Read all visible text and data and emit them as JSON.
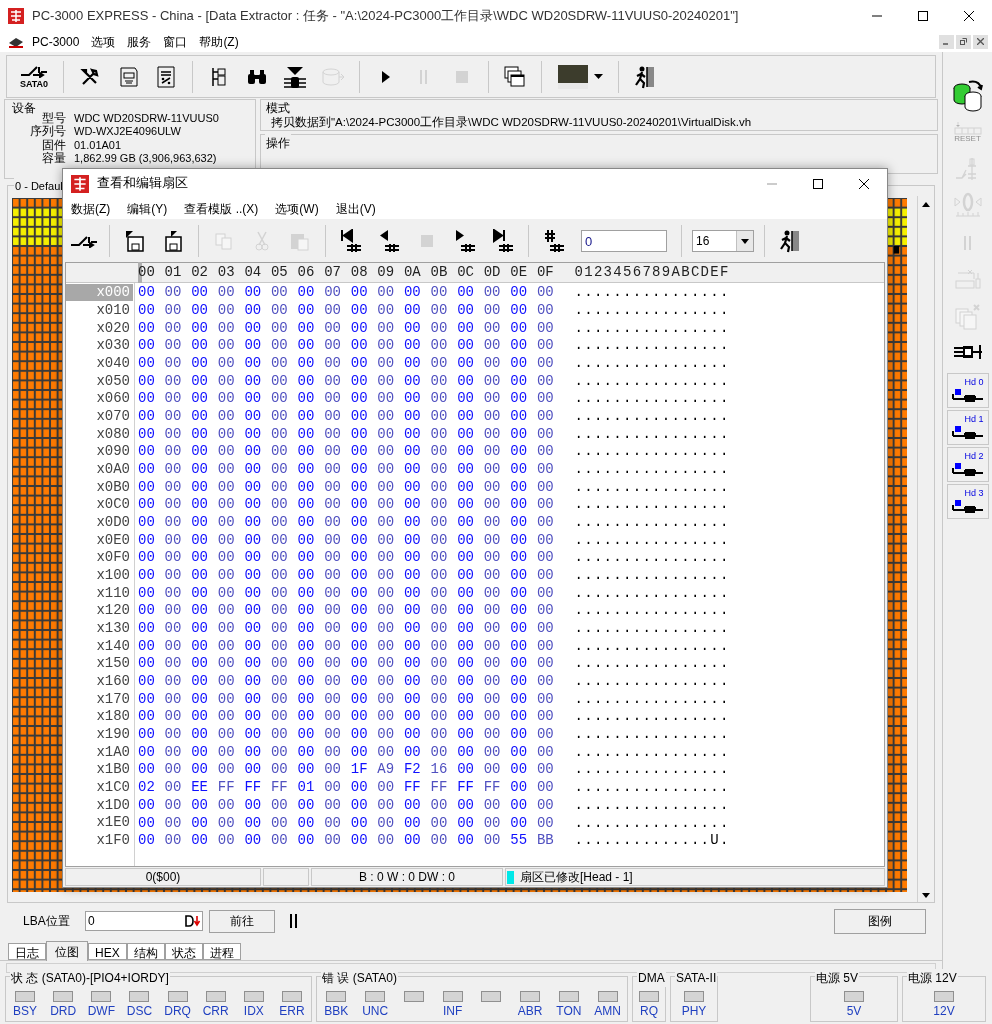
{
  "window": {
    "title": "PC-3000 EXPRESS - China - [Data Extractor : 任务 - \"A:\\2024-PC3000工作目录\\WDC WD20SDRW-11VUUS0-20240201\"]"
  },
  "menu": [
    "PC-3000",
    "选项",
    "服务",
    "窗口",
    "帮助(Z)"
  ],
  "toolbar": [
    {
      "kind": "sata",
      "label": "SATA0",
      "disabled": false
    },
    {
      "kind": "separator"
    },
    {
      "kind": "tools",
      "disabled": false
    },
    {
      "kind": "chip-doc",
      "disabled": false
    },
    {
      "kind": "percent-doc",
      "disabled": false
    },
    {
      "kind": "separator"
    },
    {
      "kind": "tree-doc",
      "disabled": false
    },
    {
      "kind": "binoculars",
      "disabled": false
    },
    {
      "kind": "disk-stack",
      "disabled": false
    },
    {
      "kind": "disk",
      "disabled": true
    },
    {
      "kind": "separator"
    },
    {
      "kind": "play",
      "disabled": false
    },
    {
      "kind": "pause",
      "disabled": true
    },
    {
      "kind": "stop",
      "disabled": true
    },
    {
      "kind": "separator"
    },
    {
      "kind": "windows",
      "disabled": false
    },
    {
      "kind": "separator"
    },
    {
      "kind": "image-dropdown",
      "disabled": false
    },
    {
      "kind": "separator"
    },
    {
      "kind": "exit",
      "disabled": false
    }
  ],
  "device": {
    "title": "设备",
    "fields": [
      {
        "label": "型号",
        "value": "WDC WD20SDRW-11VUUS0"
      },
      {
        "label": "序列号",
        "value": "WD-WXJ2E4096ULW"
      },
      {
        "label": "固件",
        "value": "01.01A01"
      },
      {
        "label": "容量",
        "value": "1,862.99 GB (3,906,963,632)"
      }
    ]
  },
  "mode": {
    "title": "模式",
    "text": "拷贝数据到\"A:\\2024-PC3000工作目录\\WDC WD20SDRW-11VUUS0-20240201\\VirtualDisk.vh"
  },
  "operation": {
    "title": "操作"
  },
  "map": {
    "title": "0 - Defaul"
  },
  "lba": {
    "label": "LBA位置",
    "value": "0",
    "go_button": "前往",
    "legend_button": "图例"
  },
  "tabs": [
    {
      "label": "日志",
      "selected": false
    },
    {
      "label": "位图",
      "selected": true
    },
    {
      "label": "HEX",
      "selected": false
    },
    {
      "label": "结构",
      "selected": false
    },
    {
      "label": "状态",
      "selected": false
    },
    {
      "label": "进程",
      "selected": false
    }
  ],
  "status_groups": [
    {
      "title": "状 态 (SATA0)-[PIO4+IORDY]",
      "leds": [
        {
          "label": "BSY",
          "on": false
        },
        {
          "label": "DRD",
          "on": false
        },
        {
          "label": "DWF",
          "on": false
        },
        {
          "label": "DSC",
          "on": false
        },
        {
          "label": "DRQ",
          "on": false
        },
        {
          "label": "CRR",
          "on": false
        },
        {
          "label": "IDX",
          "on": false
        },
        {
          "label": "ERR",
          "on": false
        }
      ]
    },
    {
      "title": "错 误 (SATA0)",
      "leds": [
        {
          "label": "BBK",
          "on": false
        },
        {
          "label": "UNC",
          "on": false
        },
        {
          "on": false
        },
        {
          "label": "INF",
          "on": false
        },
        {
          "on": false
        },
        {
          "label": "ABR",
          "on": false
        },
        {
          "label": "TON",
          "on": false
        },
        {
          "label": "AMN",
          "on": false
        }
      ]
    },
    {
      "title": "DMA",
      "leds": [
        {
          "label": "RQ",
          "on": false
        }
      ]
    },
    {
      "title": "SATA-II",
      "leds": [
        {
          "label": "PHY",
          "on": false
        }
      ]
    },
    {
      "title": "电源 5V",
      "leds": [
        {
          "label": "5V",
          "on": false
        }
      ]
    },
    {
      "title": "电源 12V",
      "leds": [
        {
          "label": "12V",
          "on": false
        }
      ]
    }
  ],
  "side_toolbar": [
    {
      "kind": "copy-disks",
      "disabled": false
    },
    {
      "kind": "reset",
      "label": "RESET",
      "disabled": true
    },
    {
      "kind": "switch",
      "disabled": true
    },
    {
      "kind": "zero",
      "disabled": true
    },
    {
      "kind": "pause",
      "disabled": true
    },
    {
      "kind": "chip-switch",
      "disabled": true
    },
    {
      "kind": "copy-pages",
      "disabled": true
    },
    {
      "kind": "connector",
      "disabled": false
    },
    {
      "kind": "head",
      "label": "Hd 0",
      "disabled": false
    },
    {
      "kind": "head",
      "label": "Hd 1",
      "disabled": false
    },
    {
      "kind": "head",
      "label": "Hd 2",
      "disabled": false
    },
    {
      "kind": "head",
      "label": "Hd 3",
      "disabled": false
    }
  ],
  "dialog": {
    "title": "查看和编辑扇区",
    "menu": [
      "数据(Z)",
      "编辑(Y)",
      "查看模版 ..(X)",
      "选项(W)",
      "退出(V)"
    ],
    "toolbar": [
      {
        "kind": "plug",
        "disabled": false
      },
      {
        "kind": "separator"
      },
      {
        "kind": "save-out",
        "disabled": false
      },
      {
        "kind": "save-in",
        "disabled": false
      },
      {
        "kind": "separator"
      },
      {
        "kind": "copy",
        "disabled": true
      },
      {
        "kind": "cut",
        "disabled": true
      },
      {
        "kind": "paste",
        "disabled": true
      },
      {
        "kind": "separator"
      },
      {
        "kind": "first",
        "disabled": false
      },
      {
        "kind": "prev",
        "disabled": false
      },
      {
        "kind": "stop",
        "disabled": true
      },
      {
        "kind": "next",
        "disabled": false
      },
      {
        "kind": "last",
        "disabled": false
      },
      {
        "kind": "separator"
      },
      {
        "kind": "goto",
        "disabled": false
      },
      {
        "kind": "field",
        "value": "0"
      },
      {
        "kind": "separator"
      },
      {
        "kind": "combo",
        "value": "16"
      },
      {
        "kind": "separator"
      },
      {
        "kind": "exit",
        "disabled": false
      }
    ],
    "hex": {
      "columns": [
        "00",
        "01",
        "02",
        "03",
        "04",
        "05",
        "06",
        "07",
        "08",
        "09",
        "0A",
        "0B",
        "0C",
        "0D",
        "0E",
        "0F"
      ],
      "ascii_header": "0123456789ABCDEF",
      "rows": [
        {
          "offset": "x000",
          "selected": true,
          "bytes": [
            "00",
            "00",
            "00",
            "00",
            "00",
            "00",
            "00",
            "00",
            "00",
            "00",
            "00",
            "00",
            "00",
            "00",
            "00",
            "00"
          ],
          "ascii": "................"
        },
        {
          "offset": "x010",
          "selected": false,
          "bytes": [
            "00",
            "00",
            "00",
            "00",
            "00",
            "00",
            "00",
            "00",
            "00",
            "00",
            "00",
            "00",
            "00",
            "00",
            "00",
            "00"
          ],
          "ascii": "................"
        },
        {
          "offset": "x020",
          "selected": false,
          "bytes": [
            "00",
            "00",
            "00",
            "00",
            "00",
            "00",
            "00",
            "00",
            "00",
            "00",
            "00",
            "00",
            "00",
            "00",
            "00",
            "00"
          ],
          "ascii": "................"
        },
        {
          "offset": "x030",
          "selected": false,
          "bytes": [
            "00",
            "00",
            "00",
            "00",
            "00",
            "00",
            "00",
            "00",
            "00",
            "00",
            "00",
            "00",
            "00",
            "00",
            "00",
            "00"
          ],
          "ascii": "................"
        },
        {
          "offset": "x040",
          "selected": false,
          "bytes": [
            "00",
            "00",
            "00",
            "00",
            "00",
            "00",
            "00",
            "00",
            "00",
            "00",
            "00",
            "00",
            "00",
            "00",
            "00",
            "00"
          ],
          "ascii": "................"
        },
        {
          "offset": "x050",
          "selected": false,
          "bytes": [
            "00",
            "00",
            "00",
            "00",
            "00",
            "00",
            "00",
            "00",
            "00",
            "00",
            "00",
            "00",
            "00",
            "00",
            "00",
            "00"
          ],
          "ascii": "................"
        },
        {
          "offset": "x060",
          "selected": false,
          "bytes": [
            "00",
            "00",
            "00",
            "00",
            "00",
            "00",
            "00",
            "00",
            "00",
            "00",
            "00",
            "00",
            "00",
            "00",
            "00",
            "00"
          ],
          "ascii": "................"
        },
        {
          "offset": "x070",
          "selected": false,
          "bytes": [
            "00",
            "00",
            "00",
            "00",
            "00",
            "00",
            "00",
            "00",
            "00",
            "00",
            "00",
            "00",
            "00",
            "00",
            "00",
            "00"
          ],
          "ascii": "................"
        },
        {
          "offset": "x080",
          "selected": false,
          "bytes": [
            "00",
            "00",
            "00",
            "00",
            "00",
            "00",
            "00",
            "00",
            "00",
            "00",
            "00",
            "00",
            "00",
            "00",
            "00",
            "00"
          ],
          "ascii": "................"
        },
        {
          "offset": "x090",
          "selected": false,
          "bytes": [
            "00",
            "00",
            "00",
            "00",
            "00",
            "00",
            "00",
            "00",
            "00",
            "00",
            "00",
            "00",
            "00",
            "00",
            "00",
            "00"
          ],
          "ascii": "................"
        },
        {
          "offset": "x0A0",
          "selected": false,
          "bytes": [
            "00",
            "00",
            "00",
            "00",
            "00",
            "00",
            "00",
            "00",
            "00",
            "00",
            "00",
            "00",
            "00",
            "00",
            "00",
            "00"
          ],
          "ascii": "................"
        },
        {
          "offset": "x0B0",
          "selected": false,
          "bytes": [
            "00",
            "00",
            "00",
            "00",
            "00",
            "00",
            "00",
            "00",
            "00",
            "00",
            "00",
            "00",
            "00",
            "00",
            "00",
            "00"
          ],
          "ascii": "................"
        },
        {
          "offset": "x0C0",
          "selected": false,
          "bytes": [
            "00",
            "00",
            "00",
            "00",
            "00",
            "00",
            "00",
            "00",
            "00",
            "00",
            "00",
            "00",
            "00",
            "00",
            "00",
            "00"
          ],
          "ascii": "................"
        },
        {
          "offset": "x0D0",
          "selected": false,
          "bytes": [
            "00",
            "00",
            "00",
            "00",
            "00",
            "00",
            "00",
            "00",
            "00",
            "00",
            "00",
            "00",
            "00",
            "00",
            "00",
            "00"
          ],
          "ascii": "................"
        },
        {
          "offset": "x0E0",
          "selected": false,
          "bytes": [
            "00",
            "00",
            "00",
            "00",
            "00",
            "00",
            "00",
            "00",
            "00",
            "00",
            "00",
            "00",
            "00",
            "00",
            "00",
            "00"
          ],
          "ascii": "................"
        },
        {
          "offset": "x0F0",
          "selected": false,
          "bytes": [
            "00",
            "00",
            "00",
            "00",
            "00",
            "00",
            "00",
            "00",
            "00",
            "00",
            "00",
            "00",
            "00",
            "00",
            "00",
            "00"
          ],
          "ascii": "................"
        },
        {
          "offset": "x100",
          "selected": false,
          "bytes": [
            "00",
            "00",
            "00",
            "00",
            "00",
            "00",
            "00",
            "00",
            "00",
            "00",
            "00",
            "00",
            "00",
            "00",
            "00",
            "00"
          ],
          "ascii": "................"
        },
        {
          "offset": "x110",
          "selected": false,
          "bytes": [
            "00",
            "00",
            "00",
            "00",
            "00",
            "00",
            "00",
            "00",
            "00",
            "00",
            "00",
            "00",
            "00",
            "00",
            "00",
            "00"
          ],
          "ascii": "................"
        },
        {
          "offset": "x120",
          "selected": false,
          "bytes": [
            "00",
            "00",
            "00",
            "00",
            "00",
            "00",
            "00",
            "00",
            "00",
            "00",
            "00",
            "00",
            "00",
            "00",
            "00",
            "00"
          ],
          "ascii": "................"
        },
        {
          "offset": "x130",
          "selected": false,
          "bytes": [
            "00",
            "00",
            "00",
            "00",
            "00",
            "00",
            "00",
            "00",
            "00",
            "00",
            "00",
            "00",
            "00",
            "00",
            "00",
            "00"
          ],
          "ascii": "................"
        },
        {
          "offset": "x140",
          "selected": false,
          "bytes": [
            "00",
            "00",
            "00",
            "00",
            "00",
            "00",
            "00",
            "00",
            "00",
            "00",
            "00",
            "00",
            "00",
            "00",
            "00",
            "00"
          ],
          "ascii": "................"
        },
        {
          "offset": "x150",
          "selected": false,
          "bytes": [
            "00",
            "00",
            "00",
            "00",
            "00",
            "00",
            "00",
            "00",
            "00",
            "00",
            "00",
            "00",
            "00",
            "00",
            "00",
            "00"
          ],
          "ascii": "................"
        },
        {
          "offset": "x160",
          "selected": false,
          "bytes": [
            "00",
            "00",
            "00",
            "00",
            "00",
            "00",
            "00",
            "00",
            "00",
            "00",
            "00",
            "00",
            "00",
            "00",
            "00",
            "00"
          ],
          "ascii": "................"
        },
        {
          "offset": "x170",
          "selected": false,
          "bytes": [
            "00",
            "00",
            "00",
            "00",
            "00",
            "00",
            "00",
            "00",
            "00",
            "00",
            "00",
            "00",
            "00",
            "00",
            "00",
            "00"
          ],
          "ascii": "................"
        },
        {
          "offset": "x180",
          "selected": false,
          "bytes": [
            "00",
            "00",
            "00",
            "00",
            "00",
            "00",
            "00",
            "00",
            "00",
            "00",
            "00",
            "00",
            "00",
            "00",
            "00",
            "00"
          ],
          "ascii": "................"
        },
        {
          "offset": "x190",
          "selected": false,
          "bytes": [
            "00",
            "00",
            "00",
            "00",
            "00",
            "00",
            "00",
            "00",
            "00",
            "00",
            "00",
            "00",
            "00",
            "00",
            "00",
            "00"
          ],
          "ascii": "................"
        },
        {
          "offset": "x1A0",
          "selected": false,
          "bytes": [
            "00",
            "00",
            "00",
            "00",
            "00",
            "00",
            "00",
            "00",
            "00",
            "00",
            "00",
            "00",
            "00",
            "00",
            "00",
            "00"
          ],
          "ascii": "................"
        },
        {
          "offset": "x1B0",
          "selected": false,
          "bytes": [
            "00",
            "00",
            "00",
            "00",
            "00",
            "00",
            "00",
            "00",
            "1F",
            "A9",
            "F2",
            "16",
            "00",
            "00",
            "00",
            "00"
          ],
          "ascii": "................"
        },
        {
          "offset": "x1C0",
          "selected": false,
          "bytes": [
            "02",
            "00",
            "EE",
            "FF",
            "FF",
            "FF",
            "01",
            "00",
            "00",
            "00",
            "FF",
            "FF",
            "FF",
            "FF",
            "00",
            "00"
          ],
          "ascii": "................"
        },
        {
          "offset": "x1D0",
          "selected": false,
          "bytes": [
            "00",
            "00",
            "00",
            "00",
            "00",
            "00",
            "00",
            "00",
            "00",
            "00",
            "00",
            "00",
            "00",
            "00",
            "00",
            "00"
          ],
          "ascii": "................"
        },
        {
          "offset": "x1E0",
          "selected": false,
          "bytes": [
            "00",
            "00",
            "00",
            "00",
            "00",
            "00",
            "00",
            "00",
            "00",
            "00",
            "00",
            "00",
            "00",
            "00",
            "00",
            "00"
          ],
          "ascii": "................"
        },
        {
          "offset": "x1F0",
          "selected": false,
          "bytes": [
            "00",
            "00",
            "00",
            "00",
            "00",
            "00",
            "00",
            "00",
            "00",
            "00",
            "00",
            "00",
            "00",
            "00",
            "55",
            "BB"
          ],
          "ascii": "..............U."
        }
      ]
    },
    "status_bar": {
      "position": "0($00)",
      "counts": "B : 0 W : 0 DW : 0",
      "message": "扇区已修改[Head - 1]"
    }
  }
}
